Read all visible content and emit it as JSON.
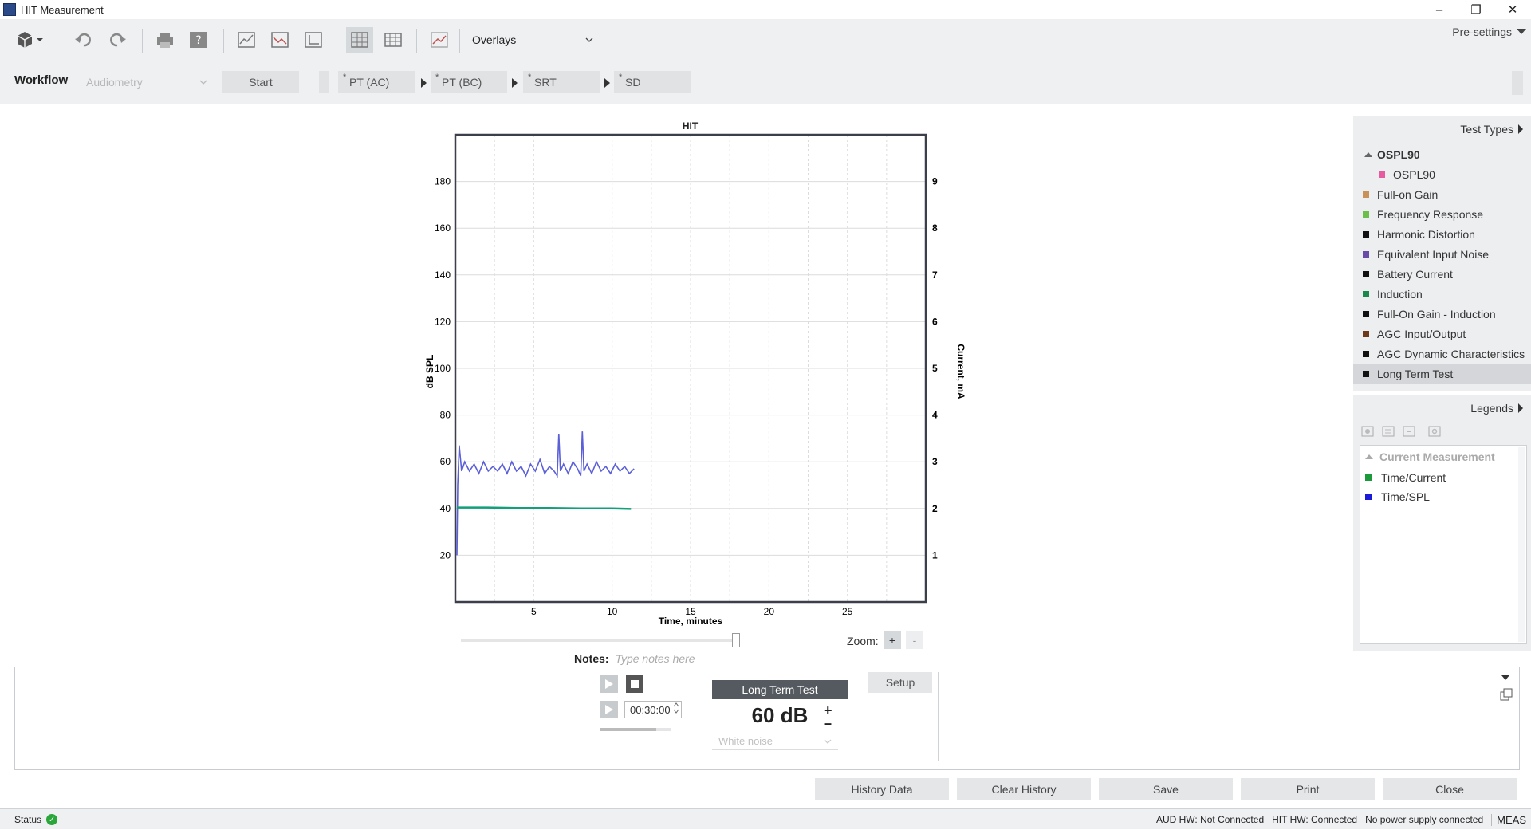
{
  "window": {
    "title": "HIT Measurement",
    "minimize": "–",
    "restore": "❐",
    "close": "✕"
  },
  "toolbar": {
    "overlays_value": "Overlays",
    "presettings_label": "Pre-settings"
  },
  "workflow": {
    "label": "Workflow",
    "dropdown_value": "Audiometry",
    "start_label": "Start",
    "steps": [
      {
        "marker": "*",
        "label": "PT (AC)"
      },
      {
        "marker": "*",
        "label": "PT (BC)"
      },
      {
        "marker": "*",
        "label": "SRT"
      },
      {
        "marker": "*",
        "label": "SD"
      }
    ]
  },
  "chart_data": {
    "type": "line",
    "title": "HIT",
    "xlabel": "Time, minutes",
    "ylabel": "dB SPL",
    "y2label": "Current, mA",
    "xlim": [
      0,
      30
    ],
    "ylim": [
      0,
      200
    ],
    "y2lim": [
      0,
      10
    ],
    "x_ticks": [
      5,
      10,
      15,
      20,
      25
    ],
    "y_ticks": [
      20,
      40,
      60,
      80,
      100,
      120,
      140,
      160,
      180
    ],
    "y2_ticks": [
      1,
      2,
      3,
      4,
      5,
      6,
      7,
      8,
      9
    ],
    "grid": true,
    "series": [
      {
        "name": "Time/SPL",
        "axis": "left",
        "color": "#5b5fd8",
        "x": [
          0.1,
          0.15,
          0.25,
          0.4,
          0.6,
          0.9,
          1.2,
          1.5,
          1.8,
          2.1,
          2.4,
          2.7,
          3.0,
          3.3,
          3.6,
          3.9,
          4.2,
          4.5,
          4.8,
          5.1,
          5.4,
          5.7,
          6.0,
          6.3,
          6.5,
          6.6,
          6.7,
          6.9,
          7.2,
          7.5,
          7.8,
          8.0,
          8.1,
          8.2,
          8.4,
          8.7,
          9.0,
          9.3,
          9.6,
          9.9,
          10.2,
          10.5,
          10.8,
          11.1,
          11.4
        ],
        "y": [
          20,
          50,
          67,
          56,
          60,
          56,
          59,
          55,
          60,
          56,
          58,
          56,
          59,
          55,
          60,
          56,
          58,
          54,
          59,
          56,
          61,
          55,
          58,
          56,
          54,
          72,
          56,
          59,
          55,
          60,
          57,
          54,
          73,
          56,
          59,
          55,
          60,
          56,
          58,
          55,
          59,
          56,
          58,
          55,
          57
        ]
      },
      {
        "name": "Time/Current",
        "axis": "right",
        "color": "#12a07a",
        "x": [
          0.1,
          2,
          4,
          6,
          8,
          10,
          11.2
        ],
        "y": [
          2.02,
          2.02,
          2.01,
          2.01,
          2.0,
          2.0,
          1.99
        ]
      }
    ]
  },
  "zoom": {
    "label": "Zoom:",
    "plus": "+",
    "minus": "-"
  },
  "test_types": {
    "header": "Test Types",
    "group": "OSPL90",
    "items": [
      {
        "label": "OSPL90",
        "color": "#e85aa0",
        "child": true
      },
      {
        "label": "Full-on Gain",
        "color": "#c8915a"
      },
      {
        "label": "Frequency Response",
        "color": "#6cc04a"
      },
      {
        "label": "Harmonic Distortion",
        "color": "#111111"
      },
      {
        "label": "Equivalent Input Noise",
        "color": "#6a4aa8"
      },
      {
        "label": "Battery Current",
        "color": "#111111"
      },
      {
        "label": "Induction",
        "color": "#1a8a4a"
      },
      {
        "label": "Full-On Gain - Induction",
        "color": "#111111"
      },
      {
        "label": "AGC Input/Output",
        "color": "#6a3a1a"
      },
      {
        "label": "AGC Dynamic Characteristics",
        "color": "#111111"
      },
      {
        "label": "Long Term Test",
        "color": "#111111",
        "selected": true
      }
    ]
  },
  "legends": {
    "header": "Legends",
    "group": "Current Measurement",
    "items": [
      {
        "label": "Time/Current",
        "color": "#1a9a3a"
      },
      {
        "label": "Time/SPL",
        "color": "#1a1ad8"
      }
    ]
  },
  "notes": {
    "label": "Notes:",
    "placeholder": "Type notes here"
  },
  "control": {
    "timer_value": "00:30:00",
    "test_label": "Long Term Test",
    "level_value": "60 dB",
    "level_plus": "+",
    "level_minus": "–",
    "signal_value": "White noise",
    "setup_label": "Setup"
  },
  "actions": {
    "history_data": "History Data",
    "clear_history": "Clear History",
    "save": "Save",
    "print": "Print",
    "close": "Close"
  },
  "status": {
    "label": "Status",
    "aud_hw": "AUD HW: Not Connected",
    "hit_hw": "HIT HW: Connected",
    "power": "No power supply connected",
    "mode": "MEAS"
  }
}
